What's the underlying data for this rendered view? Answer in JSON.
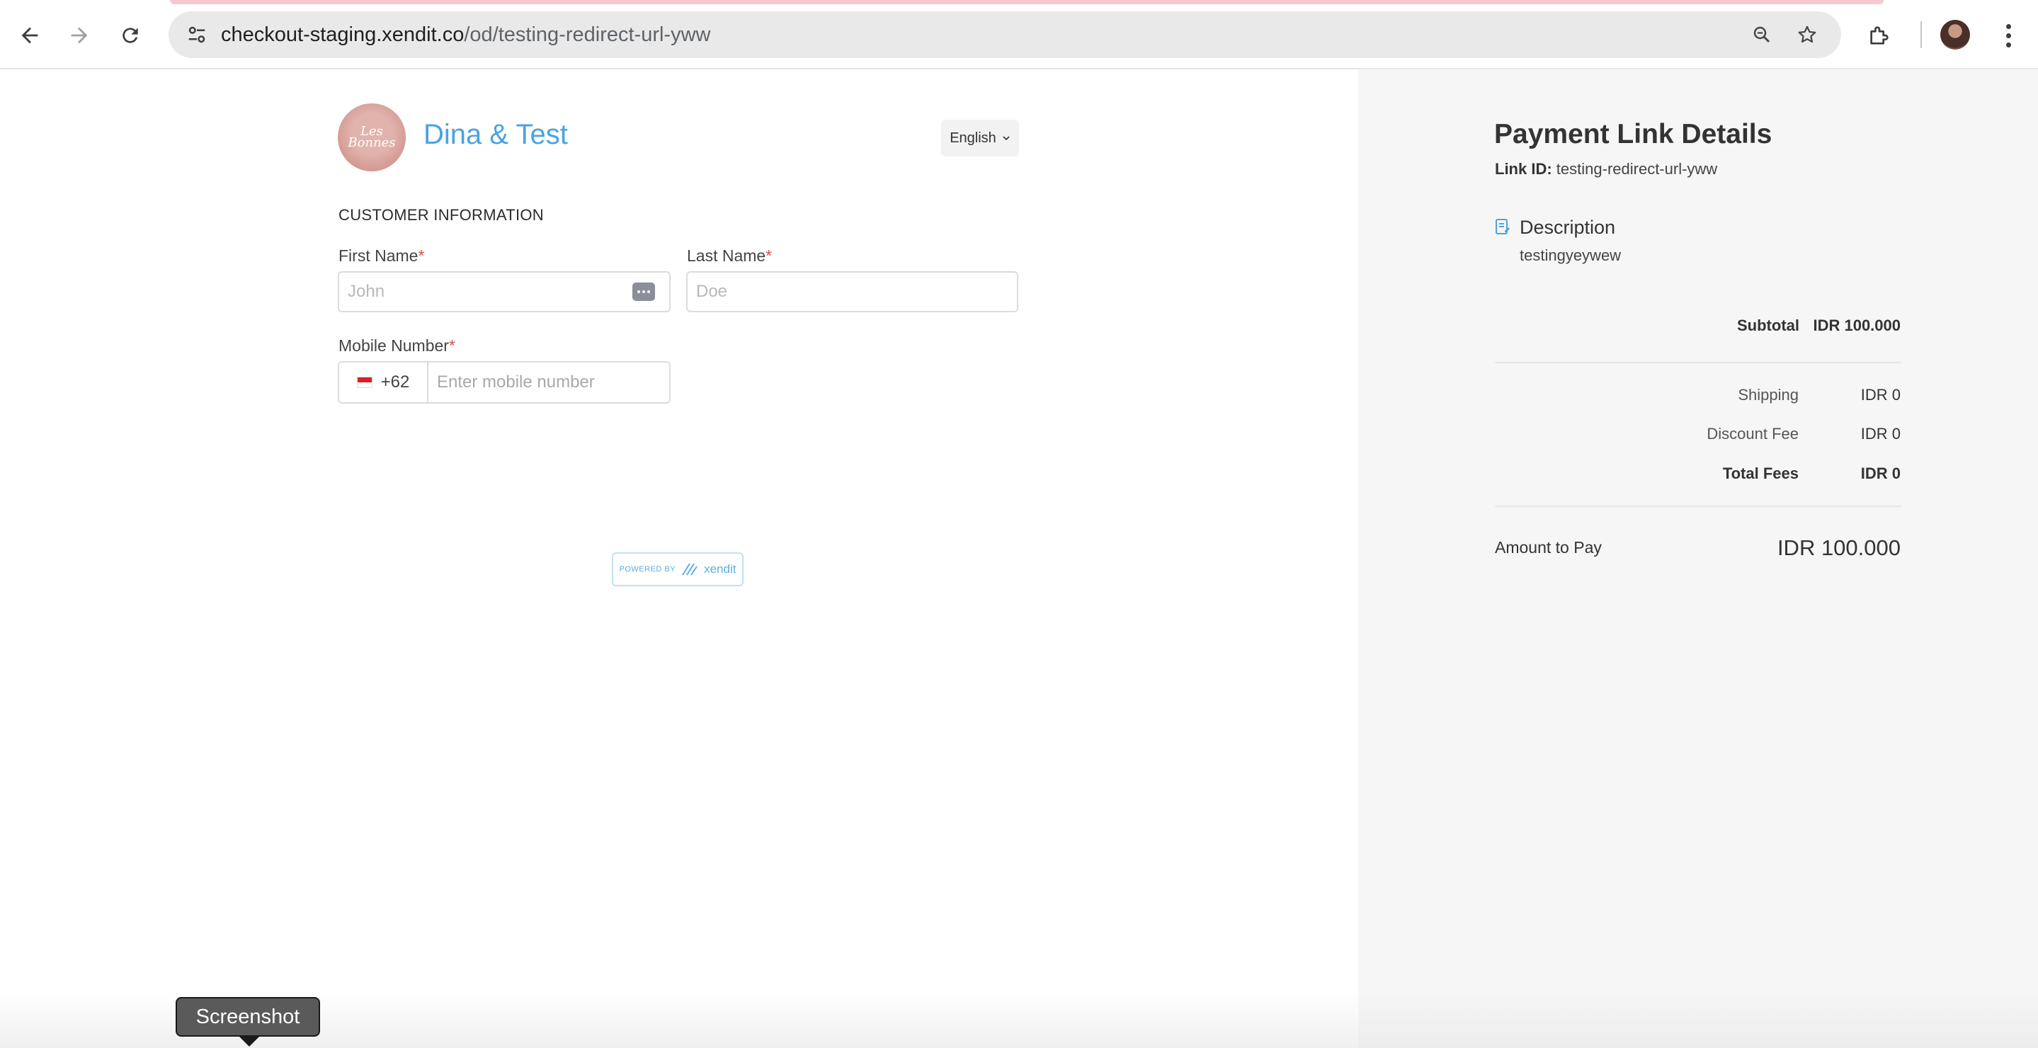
{
  "browser": {
    "url_host": "checkout-staging.xendit.co",
    "url_path": "/od/testing-redirect-url-yww"
  },
  "merchant": {
    "name": "Dina & Test",
    "logo_text": "Les Bonnes"
  },
  "language": {
    "selected": "English"
  },
  "form": {
    "section_title": "CUSTOMER INFORMATION",
    "first_name": {
      "label": "First Name",
      "required_mark": "*",
      "placeholder": "John",
      "value": ""
    },
    "last_name": {
      "label": "Last Name",
      "required_mark": "*",
      "placeholder": "Doe",
      "value": ""
    },
    "mobile": {
      "label": "Mobile Number",
      "required_mark": "*",
      "country_code": "+62",
      "placeholder": "Enter mobile number",
      "value": ""
    }
  },
  "powered_by": {
    "prefix": "POWERED BY",
    "brand": "xendit"
  },
  "summary": {
    "title": "Payment Link Details",
    "link_id_label": "Link ID:",
    "link_id_value": "testing-redirect-url-yww",
    "description_title": "Description",
    "description_text": "testingyeywew",
    "subtotal_label": "Subtotal",
    "subtotal_value": "IDR 100.000",
    "shipping_label": "Shipping",
    "shipping_value": "IDR 0",
    "discount_label": "Discount Fee",
    "discount_value": "IDR 0",
    "total_fees_label": "Total Fees",
    "total_fees_value": "IDR 0",
    "amount_label": "Amount to Pay",
    "amount_value": "IDR 100.000"
  },
  "tooltip": {
    "text": "Screenshot"
  },
  "colors": {
    "accent": "#4aa3df",
    "required": "#e04b4b",
    "panel_bg": "#f6f6f6"
  }
}
